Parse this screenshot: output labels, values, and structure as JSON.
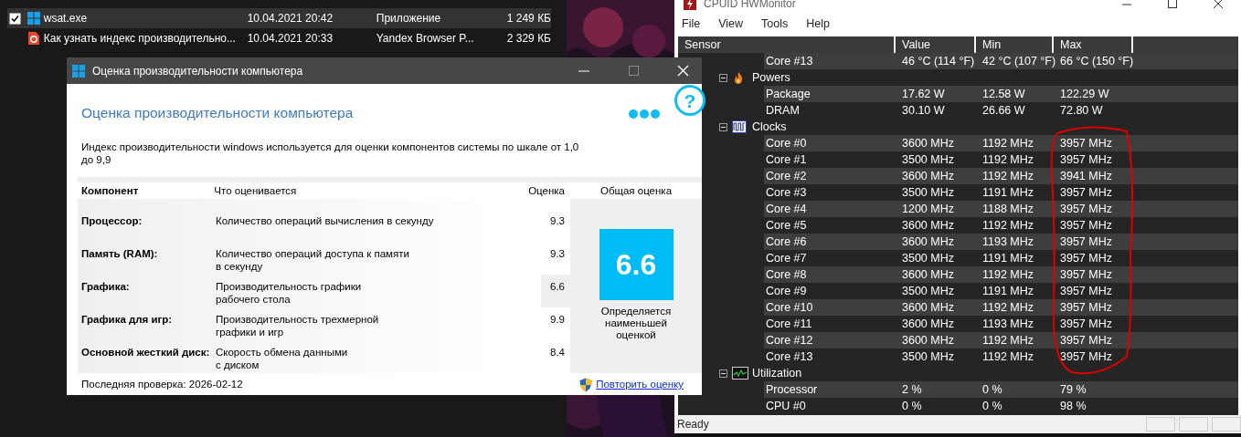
{
  "explorer": {
    "files": [
      {
        "name": "wsat.exe",
        "date": "10.04.2021 20:42",
        "type": "Приложение",
        "size": "1 249 КБ",
        "kind": "app",
        "selected": true,
        "checked": true
      },
      {
        "name": "Как узнать индекс производительно...",
        "date": "10.04.2021 20:33",
        "type": "Yandex Browser P...",
        "size": "2 329 КБ",
        "kind": "web",
        "selected": false,
        "checked": false
      }
    ]
  },
  "hwmonitor": {
    "title": "CPUID HWMonitor",
    "menu": [
      "File",
      "View",
      "Tools",
      "Help"
    ],
    "columns": [
      "Sensor",
      "Value",
      "Min",
      "Max"
    ],
    "groups": [
      {
        "children": [
          {
            "label": "Core #13",
            "value": "46 °C  (114 °F)",
            "min": "42 °C  (107 °F)",
            "max": "66 °C  (150 °F)"
          }
        ]
      },
      {
        "label": "Powers",
        "kind": "power",
        "expanded": true,
        "children": [
          {
            "label": "Package",
            "value": "17.62 W",
            "min": "12.58 W",
            "max": "122.29 W"
          },
          {
            "label": "DRAM",
            "value": "30.10 W",
            "min": "26.66 W",
            "max": "72.80 W"
          }
        ]
      },
      {
        "label": "Clocks",
        "kind": "clock",
        "expanded": true,
        "children": [
          {
            "label": "Core #0",
            "value": "3600 MHz",
            "min": "1192 MHz",
            "max": "3957 MHz"
          },
          {
            "label": "Core #1",
            "value": "3500 MHz",
            "min": "1192 MHz",
            "max": "3957 MHz"
          },
          {
            "label": "Core #2",
            "value": "3600 MHz",
            "min": "1192 MHz",
            "max": "3941 MHz"
          },
          {
            "label": "Core #3",
            "value": "3500 MHz",
            "min": "1191 MHz",
            "max": "3957 MHz"
          },
          {
            "label": "Core #4",
            "value": "1200 MHz",
            "min": "1188 MHz",
            "max": "3957 MHz"
          },
          {
            "label": "Core #5",
            "value": "3600 MHz",
            "min": "1192 MHz",
            "max": "3957 MHz"
          },
          {
            "label": "Core #6",
            "value": "3600 MHz",
            "min": "1193 MHz",
            "max": "3957 MHz"
          },
          {
            "label": "Core #7",
            "value": "3500 MHz",
            "min": "1191 MHz",
            "max": "3957 MHz"
          },
          {
            "label": "Core #8",
            "value": "3600 MHz",
            "min": "1192 MHz",
            "max": "3957 MHz"
          },
          {
            "label": "Core #9",
            "value": "3500 MHz",
            "min": "1191 MHz",
            "max": "3957 MHz"
          },
          {
            "label": "Core #10",
            "value": "3600 MHz",
            "min": "1192 MHz",
            "max": "3957 MHz"
          },
          {
            "label": "Core #11",
            "value": "3600 MHz",
            "min": "1193 MHz",
            "max": "3957 MHz"
          },
          {
            "label": "Core #12",
            "value": "3600 MHz",
            "min": "1192 MHz",
            "max": "3957 MHz"
          },
          {
            "label": "Core #13",
            "value": "3500 MHz",
            "min": "1192 MHz",
            "max": "3957 MHz"
          }
        ]
      },
      {
        "label": "Utilization",
        "kind": "utilization",
        "expanded": true,
        "children": [
          {
            "label": "Processor",
            "value": "2 %",
            "min": "0 %",
            "max": "79 %"
          },
          {
            "label": "CPU #0",
            "value": "0 %",
            "min": "0 %",
            "max": "98 %"
          }
        ]
      }
    ],
    "status": "Ready"
  },
  "wsat": {
    "title": "Оценка производительности компьютера",
    "heading": "Оценка производительности компьютера",
    "help_symbol": "?",
    "description": "Индекс производительности windows используется для оценки компонентов системы по шкале от 1,0 до 9,9",
    "columns": [
      "Компонент",
      "Что оценивается",
      "Оценка",
      "Общая оценка"
    ],
    "rows": [
      {
        "component": "Процессор:",
        "measures": "Количество операций вычисления в секунду",
        "score": "9.3",
        "lowest": false
      },
      {
        "component": "Память (RAM):",
        "measures": "Количество операций доступа к памяти\nв секунду",
        "score": "9.3",
        "lowest": false
      },
      {
        "component": "Графика:",
        "measures": "Производительность графики\nрабочего стола",
        "score": "6.6",
        "lowest": true
      },
      {
        "component": "Графика для игр:",
        "measures": "Производительность трехмерной\nграфики и игр",
        "score": "9.9",
        "lowest": false
      },
      {
        "component": "Основной жесткий диск:",
        "measures": "Скорость обмена данными\nс диском",
        "score": "8.4",
        "lowest": false
      }
    ],
    "base_score": "6.6",
    "base_note": "Определяется наименьшей оценкой",
    "last_check": "Последняя проверка: 2026-02-12",
    "rerun_link": "Повторить оценку"
  }
}
